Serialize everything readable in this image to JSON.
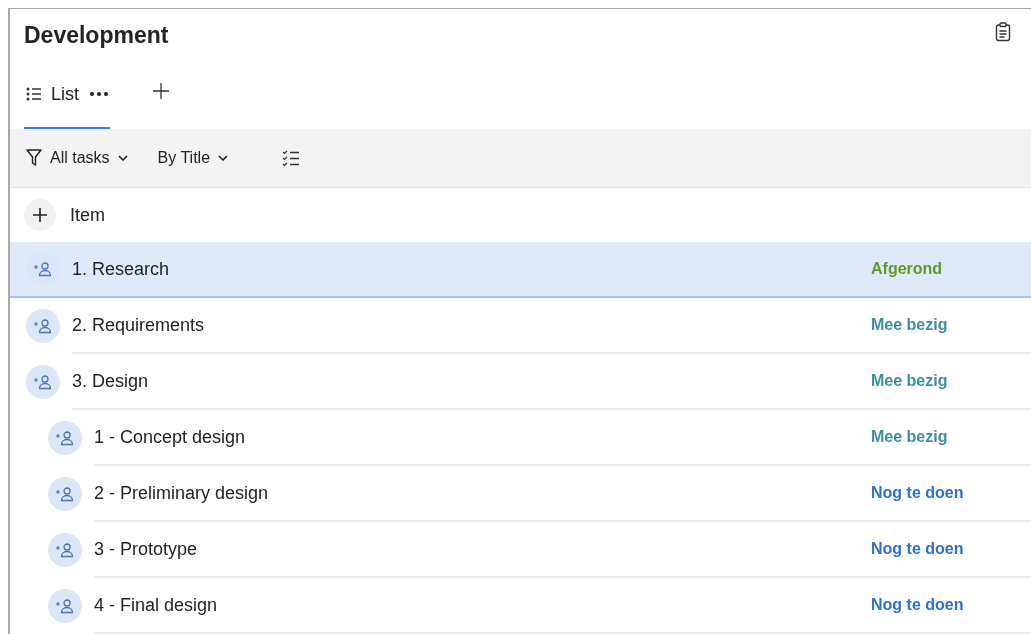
{
  "title": "Development",
  "tabs": [
    {
      "label": "List",
      "selected": true
    }
  ],
  "toolbar": {
    "filter": "All tasks",
    "sort": "By Title"
  },
  "add_item": {
    "label": "Item"
  },
  "tasks": [
    {
      "title": "1. Research",
      "status": "Afgerond",
      "color": "#5e9a2a",
      "selected": true
    },
    {
      "title": "2. Requirements",
      "status": "Mee bezig",
      "color": "#3d8f9e",
      "selected": false
    },
    {
      "title": "3. Design",
      "status": "Mee bezig",
      "color": "#3d8f9e",
      "selected": false,
      "children": [
        {
          "title": "1 - Concept design",
          "status": "Mee bezig",
          "color": "#3d8f9e",
          "selected": false
        },
        {
          "title": "2 - Preliminary design",
          "status": "Nog te doen",
          "color": "#2f6fd1",
          "selected": false
        },
        {
          "title": "3 - Prototype",
          "status": "Nog te doen",
          "color": "#2f6fd1",
          "selected": false
        },
        {
          "title": "4 - Final design",
          "status": "Nog te doen",
          "color": "#2f6fd1",
          "selected": false
        }
      ]
    }
  ]
}
